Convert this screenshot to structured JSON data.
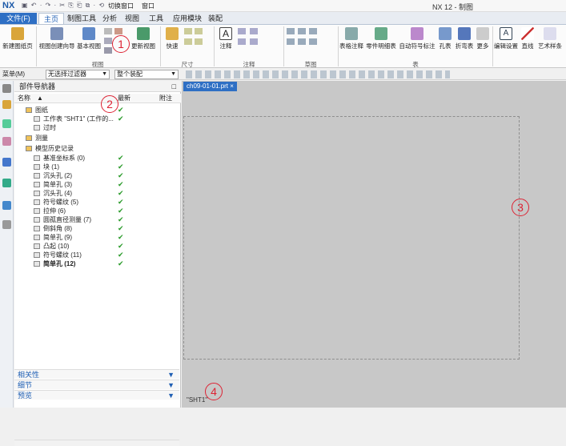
{
  "titlebar": {
    "logo": "NX",
    "quick_access": "▣ ↶ · ↷ · ✂ ⎘ ⎗ ⧉ · ⟲",
    "window_switch": "切换窗口",
    "window_menu": "窗口",
    "title": "NX 12 - 制图"
  },
  "tabs": [
    "文件(F)",
    "主页",
    "制图工具",
    "分析",
    "视图",
    "工具",
    "应用模块",
    "装配"
  ],
  "ribbon": {
    "new_sheet": "新建图纸页",
    "view_wizard": "视图创建向导",
    "base_view": "基本视图",
    "update_view": "更新视图",
    "group_view": "视图",
    "quick": "快速",
    "group_dimension": "尺寸",
    "annotation": "注释",
    "group_annotation": "注释",
    "group_sketch": "草图",
    "hole_table": "表格注释",
    "parts_list": "零件明细表",
    "auto_balloon": "自动符号标注",
    "hole_table2": "孔表",
    "bend_table": "折弯表",
    "more": "更多",
    "group_table": "表",
    "edit_settings": "编辑设置",
    "line": "直线",
    "art_spline": "艺术样条"
  },
  "cmdbar": {
    "menu": "菜单(M)",
    "filter": "无选择过滤器",
    "assembly": "整个装配"
  },
  "navigator": {
    "title": "部件导航器",
    "col_name": "名称",
    "col_latest": "最新",
    "col_note": "附注",
    "rows": [
      {
        "label": "图纸",
        "indent": 0,
        "check": "✔",
        "bold": false
      },
      {
        "label": "工作表 \"SHT1\" (工作的...",
        "indent": 1,
        "check": "✔",
        "bold": false
      },
      {
        "label": "过时",
        "indent": 1,
        "check": "",
        "bold": false
      },
      {
        "label": "测量",
        "indent": 0,
        "check": "",
        "bold": false
      },
      {
        "label": "模型历史记录",
        "indent": 0,
        "check": "",
        "bold": false
      },
      {
        "label": "基准坐标系 (0)",
        "indent": 1,
        "check": "✔",
        "bold": false
      },
      {
        "label": "块 (1)",
        "indent": 1,
        "check": "✔",
        "bold": false
      },
      {
        "label": "沉头孔 (2)",
        "indent": 1,
        "check": "✔",
        "bold": false
      },
      {
        "label": "简单孔 (3)",
        "indent": 1,
        "check": "✔",
        "bold": false
      },
      {
        "label": "沉头孔 (4)",
        "indent": 1,
        "check": "✔",
        "bold": false
      },
      {
        "label": "符号螺纹 (5)",
        "indent": 1,
        "check": "✔",
        "bold": false
      },
      {
        "label": "拉伸 (6)",
        "indent": 1,
        "check": "✔",
        "bold": false
      },
      {
        "label": "圆孤直径测量 (7)",
        "indent": 1,
        "check": "✔",
        "bold": false
      },
      {
        "label": "倒斜角 (8)",
        "indent": 1,
        "check": "✔",
        "bold": false
      },
      {
        "label": "简单孔 (9)",
        "indent": 1,
        "check": "✔",
        "bold": false
      },
      {
        "label": "凸起 (10)",
        "indent": 1,
        "check": "✔",
        "bold": false
      },
      {
        "label": "符号螺纹 (11)",
        "indent": 1,
        "check": "✔",
        "bold": false
      },
      {
        "label": "简单孔 (12)",
        "indent": 1,
        "check": "✔",
        "bold": true
      }
    ],
    "panels": [
      "相关性",
      "细节",
      "预览"
    ]
  },
  "document": {
    "tab": "ch09-01-01.prt",
    "sheet_label": "\"SHT1\""
  },
  "callouts": [
    "1",
    "2",
    "3",
    "4"
  ],
  "colors": {
    "accent": "#2e6fc4",
    "callout": "#d23",
    "check": "#2a9b2a"
  }
}
